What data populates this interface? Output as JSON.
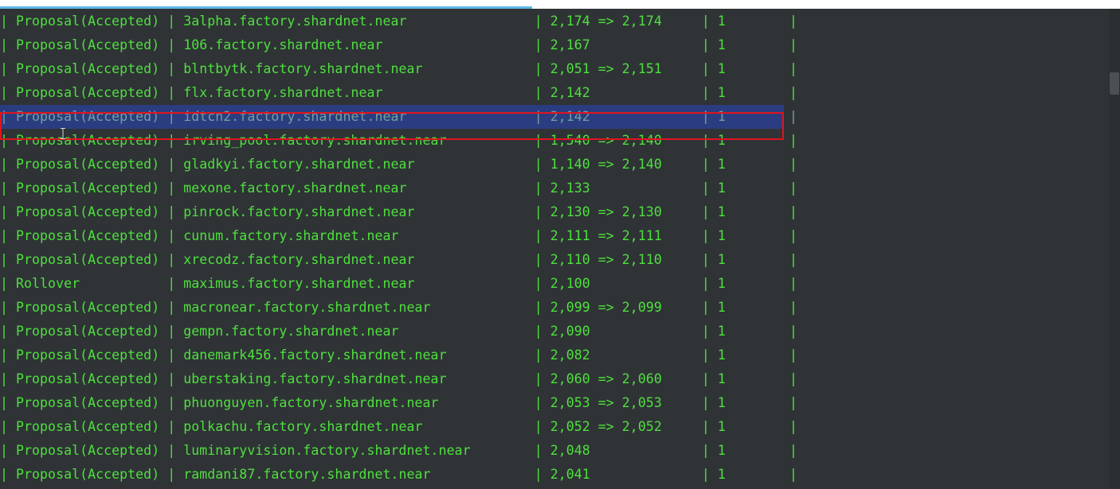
{
  "rows": [
    "| Proposal(Accepted) | 3alpha.factory.shardnet.near                | 2,174 => 2,174     | 1        |",
    "| Proposal(Accepted) | 106.factory.shardnet.near                   | 2,167              | 1        |",
    "| Proposal(Accepted) | blntbytk.factory.shardnet.near              | 2,051 => 2,151     | 1        |",
    "| Proposal(Accepted) | flx.factory.shardnet.near                   | 2,142              | 1        |",
    "| Proposal(Accepted) | idtcn2.factory.shardnet.near                | 2,142              | 1        |",
    "| Proposal(Accepted) | irving_pool.factory.shardnet.near           | 1,540 => 2,140     | 1        |",
    "| Proposal(Accepted) | gladkyi.factory.shardnet.near               | 1,140 => 2,140     | 1        |",
    "| Proposal(Accepted) | mexone.factory.shardnet.near                | 2,133              | 1        |",
    "| Proposal(Accepted) | pinrock.factory.shardnet.near               | 2,130 => 2,130     | 1        |",
    "| Proposal(Accepted) | cunum.factory.shardnet.near                 | 2,111 => 2,111     | 1        |",
    "| Proposal(Accepted) | xrecodz.factory.shardnet.near               | 2,110 => 2,110     | 1        |",
    "| Rollover           | maximus.factory.shardnet.near               | 2,100              | 1        |",
    "| Proposal(Accepted) | macronear.factory.shardnet.near             | 2,099 => 2,099     | 1        |",
    "| Proposal(Accepted) | gempn.factory.shardnet.near                 | 2,090              | 1        |",
    "| Proposal(Accepted) | danemark456.factory.shardnet.near           | 2,082              | 1        |",
    "| Proposal(Accepted) | uberstaking.factory.shardnet.near           | 2,060 => 2,060     | 1        |",
    "| Proposal(Accepted) | phuonguyen.factory.shardnet.near            | 2,053 => 2,053     | 1        |",
    "| Proposal(Accepted) | polkachu.factory.shardnet.near              | 2,052 => 2,052     | 1        |",
    "| Proposal(Accepted) | luminaryvision.factory.shardnet.near        | 2,048              | 1        |",
    "| Proposal(Accepted) | ramdani87.factory.shardnet.near             | 2,041              | 1        |"
  ],
  "highlighted_row_index": 4,
  "colors": {
    "background": "#2f3336",
    "text": "#4ee03d",
    "selection_bg": "#2b3d80",
    "selection_border": "#e0141e"
  }
}
